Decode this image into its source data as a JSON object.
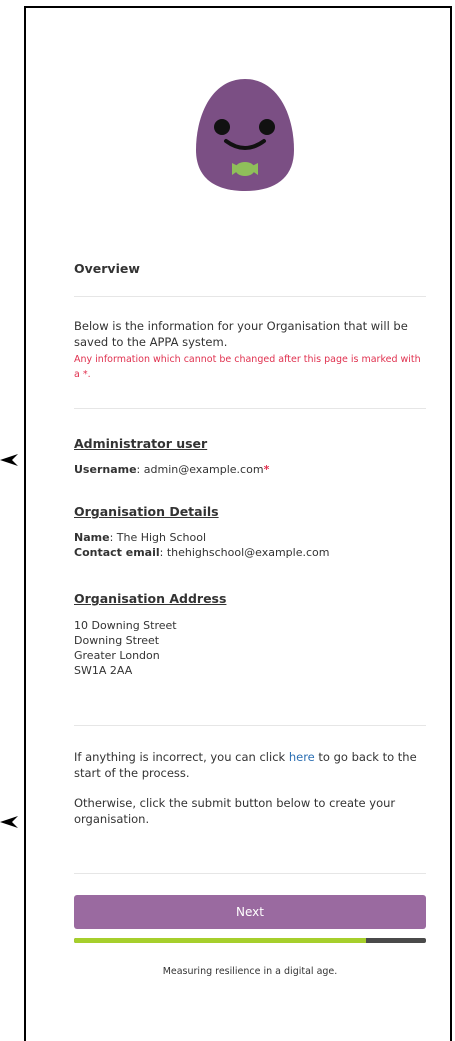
{
  "overview": {
    "title": "Overview",
    "intro": "Below is the information for your Organisation that will be saved to the APPA system.",
    "warning": "Any information which cannot be changed after this page is marked with a *."
  },
  "admin": {
    "title": "Administrator user",
    "username_label": "Username",
    "username_value": ": admin@example.com",
    "required_mark": "*"
  },
  "org_details": {
    "title": "Organisation Details",
    "name_label": "Name",
    "name_value": ": The High School",
    "email_label": "Contact email",
    "email_value": ": thehighschool@example.com"
  },
  "org_address": {
    "title": "Organisation Address",
    "lines": [
      "10 Downing Street",
      "Downing Street",
      "Greater London",
      "SW1A 2AA"
    ]
  },
  "notes": {
    "incorrect_before": "If anything is incorrect, you can click ",
    "incorrect_link": "here",
    "incorrect_after": " to go back to the start of the process.",
    "submit": "Otherwise, click the submit button below to create your organisation."
  },
  "next_button": {
    "label": "Next"
  },
  "progress": {
    "fraction": 0.83
  },
  "footer": {
    "tagline": "Measuring resilience in a digital age."
  },
  "colors": {
    "brand": "#9a6aa0",
    "warning": "#e0314f",
    "progress": "#a6cf2c",
    "link": "#2c6fb3"
  }
}
